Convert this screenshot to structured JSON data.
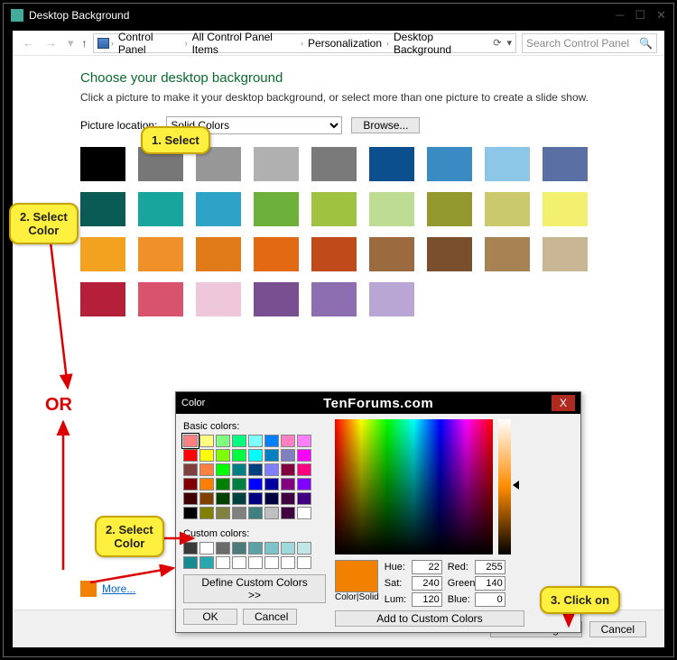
{
  "window": {
    "title": "Desktop Background"
  },
  "nav": {
    "crumbs": [
      "Control Panel",
      "All Control Panel Items",
      "Personalization",
      "Desktop Background"
    ],
    "search_placeholder": "Search Control Panel"
  },
  "page": {
    "heading": "Choose your desktop background",
    "subtext": "Click a picture to make it your desktop background, or select more than one picture to create a slide show.",
    "pic_loc_label": "Picture location:",
    "pic_loc_value": "Solid Colors",
    "browse": "Browse...",
    "more": "More...",
    "save": "Save changes",
    "cancel": "Cancel"
  },
  "swatches": [
    "#000000",
    "#777777",
    "#979797",
    "#b0b0b0",
    "#7a7a7a",
    "#0b4f8f",
    "#3a8bc3",
    "#8dc7e8",
    "#5a6fa3",
    "#0a5a56",
    "#18a59d",
    "#2fa2c7",
    "#6db13b",
    "#9fc241",
    "#bedc93",
    "#93992e",
    "#cbc96d",
    "#f3ef6f",
    "#f3a21f",
    "#f09028",
    "#e17a18",
    "#e36a13",
    "#c14a1a",
    "#9c6a3f",
    "#7a4f2e",
    "#a78353",
    "#c9b694",
    "#b51f3a",
    "#d8536d",
    "#eec7da",
    "#7a4f91",
    "#8d6fb1",
    "#b9a6d4"
  ],
  "color_dialog": {
    "title": "Color",
    "brand": "TenForums.com",
    "basic_label": "Basic colors:",
    "custom_label": "Custom colors:",
    "define": "Define Custom Colors >>",
    "ok": "OK",
    "cancel": "Cancel",
    "color_solid": "Color|Solid",
    "hue": "Hue:",
    "sat": "Sat:",
    "lum": "Lum:",
    "red": "Red:",
    "green": "Green:",
    "blue": "Blue:",
    "hue_v": "22",
    "sat_v": "240",
    "lum_v": "120",
    "red_v": "255",
    "green_v": "140",
    "blue_v": "0",
    "add": "Add to Custom Colors",
    "basic_colors": [
      "#ff8080",
      "#ffff80",
      "#80ff80",
      "#00ff80",
      "#80ffff",
      "#0080ff",
      "#ff80c0",
      "#ff80ff",
      "#ff0000",
      "#ffff00",
      "#80ff00",
      "#00ff40",
      "#00ffff",
      "#0080c0",
      "#8080c0",
      "#ff00ff",
      "#804040",
      "#ff8040",
      "#00ff00",
      "#008080",
      "#004080",
      "#8080ff",
      "#800040",
      "#ff0080",
      "#800000",
      "#ff8000",
      "#008000",
      "#008040",
      "#0000ff",
      "#0000a0",
      "#800080",
      "#8000ff",
      "#400000",
      "#804000",
      "#004000",
      "#004040",
      "#000080",
      "#000040",
      "#400040",
      "#400080",
      "#000000",
      "#808000",
      "#808040",
      "#808080",
      "#408080",
      "#c0c0c0",
      "#400040",
      "#ffffff"
    ],
    "custom_colors": [
      "#3a3a3a",
      "#ffffff",
      "#6b6b6b",
      "#4a7a7a",
      "#5da0a6",
      "#7ec3c9",
      "#a0d8dc",
      "#c2e6e8",
      "#1a8a92",
      "#2aa6ae",
      "#ffffff",
      "#ffffff",
      "#ffffff",
      "#ffffff",
      "#ffffff",
      "#ffffff"
    ]
  },
  "callouts": {
    "c1": "1. Select",
    "c2": "2. Select\nColor",
    "c3": "2. Select\nColor",
    "c4": "3. Click on",
    "or": "OR"
  }
}
